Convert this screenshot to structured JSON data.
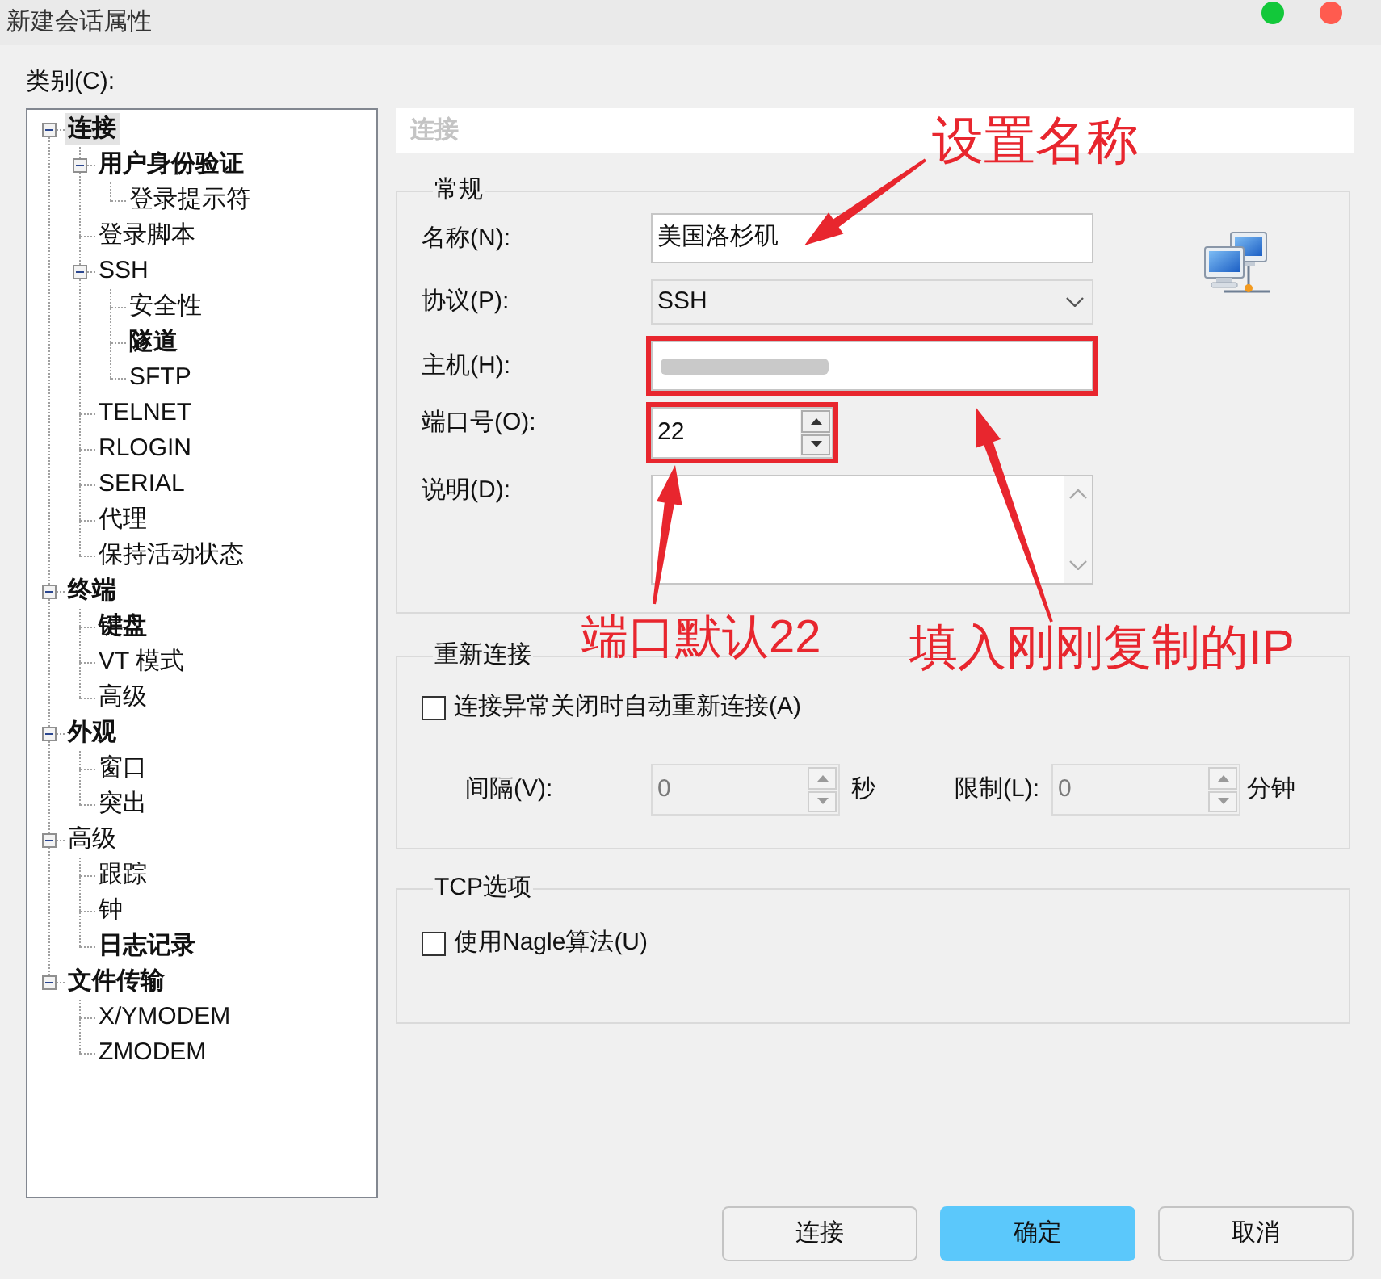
{
  "window": {
    "title": "新建会话属性",
    "controls": [
      {
        "color": "#12c83a"
      },
      {
        "color": "#ff5b4f"
      }
    ]
  },
  "category_label": "类别(C):",
  "category_tree": [
    {
      "label": "连接",
      "bold": true,
      "selected": true,
      "expanded": true,
      "children": [
        {
          "label": "用户身份验证",
          "bold": true,
          "selected": false,
          "expanded": true,
          "children": [
            {
              "label": "登录提示符",
              "bold": false,
              "selected": false
            }
          ]
        },
        {
          "label": "登录脚本",
          "bold": false,
          "selected": false
        },
        {
          "label": "SSH",
          "bold": false,
          "selected": false,
          "expanded": true,
          "children": [
            {
              "label": "安全性",
              "bold": false,
              "selected": false
            },
            {
              "label": "隧道",
              "bold": true,
              "selected": false
            },
            {
              "label": "SFTP",
              "bold": false,
              "selected": false
            }
          ]
        },
        {
          "label": "TELNET",
          "bold": false,
          "selected": false
        },
        {
          "label": "RLOGIN",
          "bold": false,
          "selected": false
        },
        {
          "label": "SERIAL",
          "bold": false,
          "selected": false
        },
        {
          "label": "代理",
          "bold": false,
          "selected": false
        },
        {
          "label": "保持活动状态",
          "bold": false,
          "selected": false
        }
      ]
    },
    {
      "label": "终端",
      "bold": true,
      "selected": false,
      "expanded": true,
      "children": [
        {
          "label": "键盘",
          "bold": true,
          "selected": false
        },
        {
          "label": "VT 模式",
          "bold": false,
          "selected": false
        },
        {
          "label": "高级",
          "bold": false,
          "selected": false
        }
      ]
    },
    {
      "label": "外观",
      "bold": true,
      "selected": false,
      "expanded": true,
      "children": [
        {
          "label": "窗口",
          "bold": false,
          "selected": false
        },
        {
          "label": "突出",
          "bold": false,
          "selected": false
        }
      ]
    },
    {
      "label": "高级",
      "bold": false,
      "selected": false,
      "expanded": true,
      "children": [
        {
          "label": "跟踪",
          "bold": false,
          "selected": false
        },
        {
          "label": "钟",
          "bold": false,
          "selected": false
        },
        {
          "label": "日志记录",
          "bold": true,
          "selected": false
        }
      ]
    },
    {
      "label": "文件传输",
      "bold": true,
      "selected": false,
      "expanded": true,
      "children": [
        {
          "label": "X/YMODEM",
          "bold": false,
          "selected": false
        },
        {
          "label": "ZMODEM",
          "bold": false,
          "selected": false
        }
      ]
    }
  ],
  "page_header": "连接",
  "general": {
    "legend": "常规",
    "fields": [
      {
        "kind": "text",
        "label": "名称(N):",
        "value": "美国洛杉矶"
      },
      {
        "kind": "dropdown",
        "label": "协议(P):",
        "value": "SSH"
      },
      {
        "kind": "text",
        "label": "主机(H):",
        "redacted": true,
        "highlighted": true
      },
      {
        "kind": "spin",
        "label": "端口号(O):",
        "value": "22",
        "highlighted": true
      },
      {
        "kind": "textarea",
        "label": "说明(D):"
      }
    ]
  },
  "reconnect": {
    "legend": "重新连接",
    "checkbox": {
      "label": "连接异常关闭时自动重新连接(A)",
      "checked": false
    },
    "interval": {
      "label": "间隔(V):",
      "value": "0",
      "unit": "秒",
      "disabled": true
    },
    "limit": {
      "label": "限制(L):",
      "value": "0",
      "unit": "分钟",
      "disabled": true
    }
  },
  "tcp_options": {
    "legend": "TCP选项",
    "checkbox": {
      "label": "使用Nagle算法(U)",
      "checked": false
    }
  },
  "buttons": [
    {
      "label": "连接",
      "primary": false
    },
    {
      "label": "确定",
      "primary": true
    },
    {
      "label": "取消",
      "primary": false
    }
  ],
  "annotations": [
    {
      "text": "设置名称"
    },
    {
      "text": "端口默认22"
    },
    {
      "text": "填入刚刚复制的IP"
    }
  ]
}
